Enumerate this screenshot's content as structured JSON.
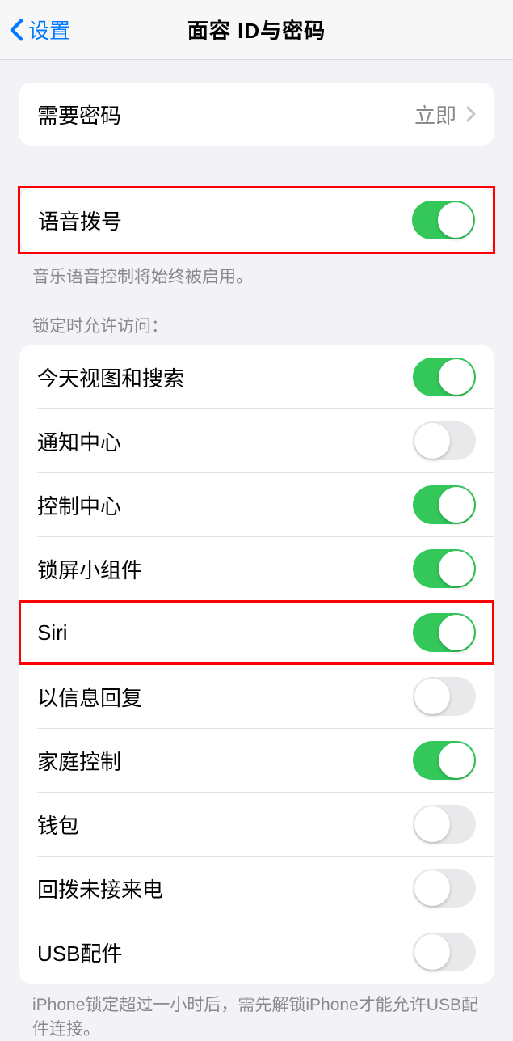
{
  "nav": {
    "back_label": "设置",
    "title": "面容 ID与密码"
  },
  "require_passcode": {
    "label": "需要密码",
    "value": "立即"
  },
  "voice_dial": {
    "label": "语音拨号",
    "on": true,
    "footer": "音乐语音控制将始终被启用。"
  },
  "lock_access": {
    "header": "锁定时允许访问：",
    "items": [
      {
        "label": "今天视图和搜索",
        "on": true
      },
      {
        "label": "通知中心",
        "on": false
      },
      {
        "label": "控制中心",
        "on": true
      },
      {
        "label": "锁屏小组件",
        "on": true
      },
      {
        "label": "Siri",
        "on": true
      },
      {
        "label": "以信息回复",
        "on": false
      },
      {
        "label": "家庭控制",
        "on": true
      },
      {
        "label": "钱包",
        "on": false
      },
      {
        "label": "回拨未接来电",
        "on": false
      },
      {
        "label": "USB配件",
        "on": false
      }
    ],
    "footer": "iPhone锁定超过一小时后，需先解锁iPhone才能允许USB配件连接。"
  },
  "highlighted_rows": [
    4
  ]
}
